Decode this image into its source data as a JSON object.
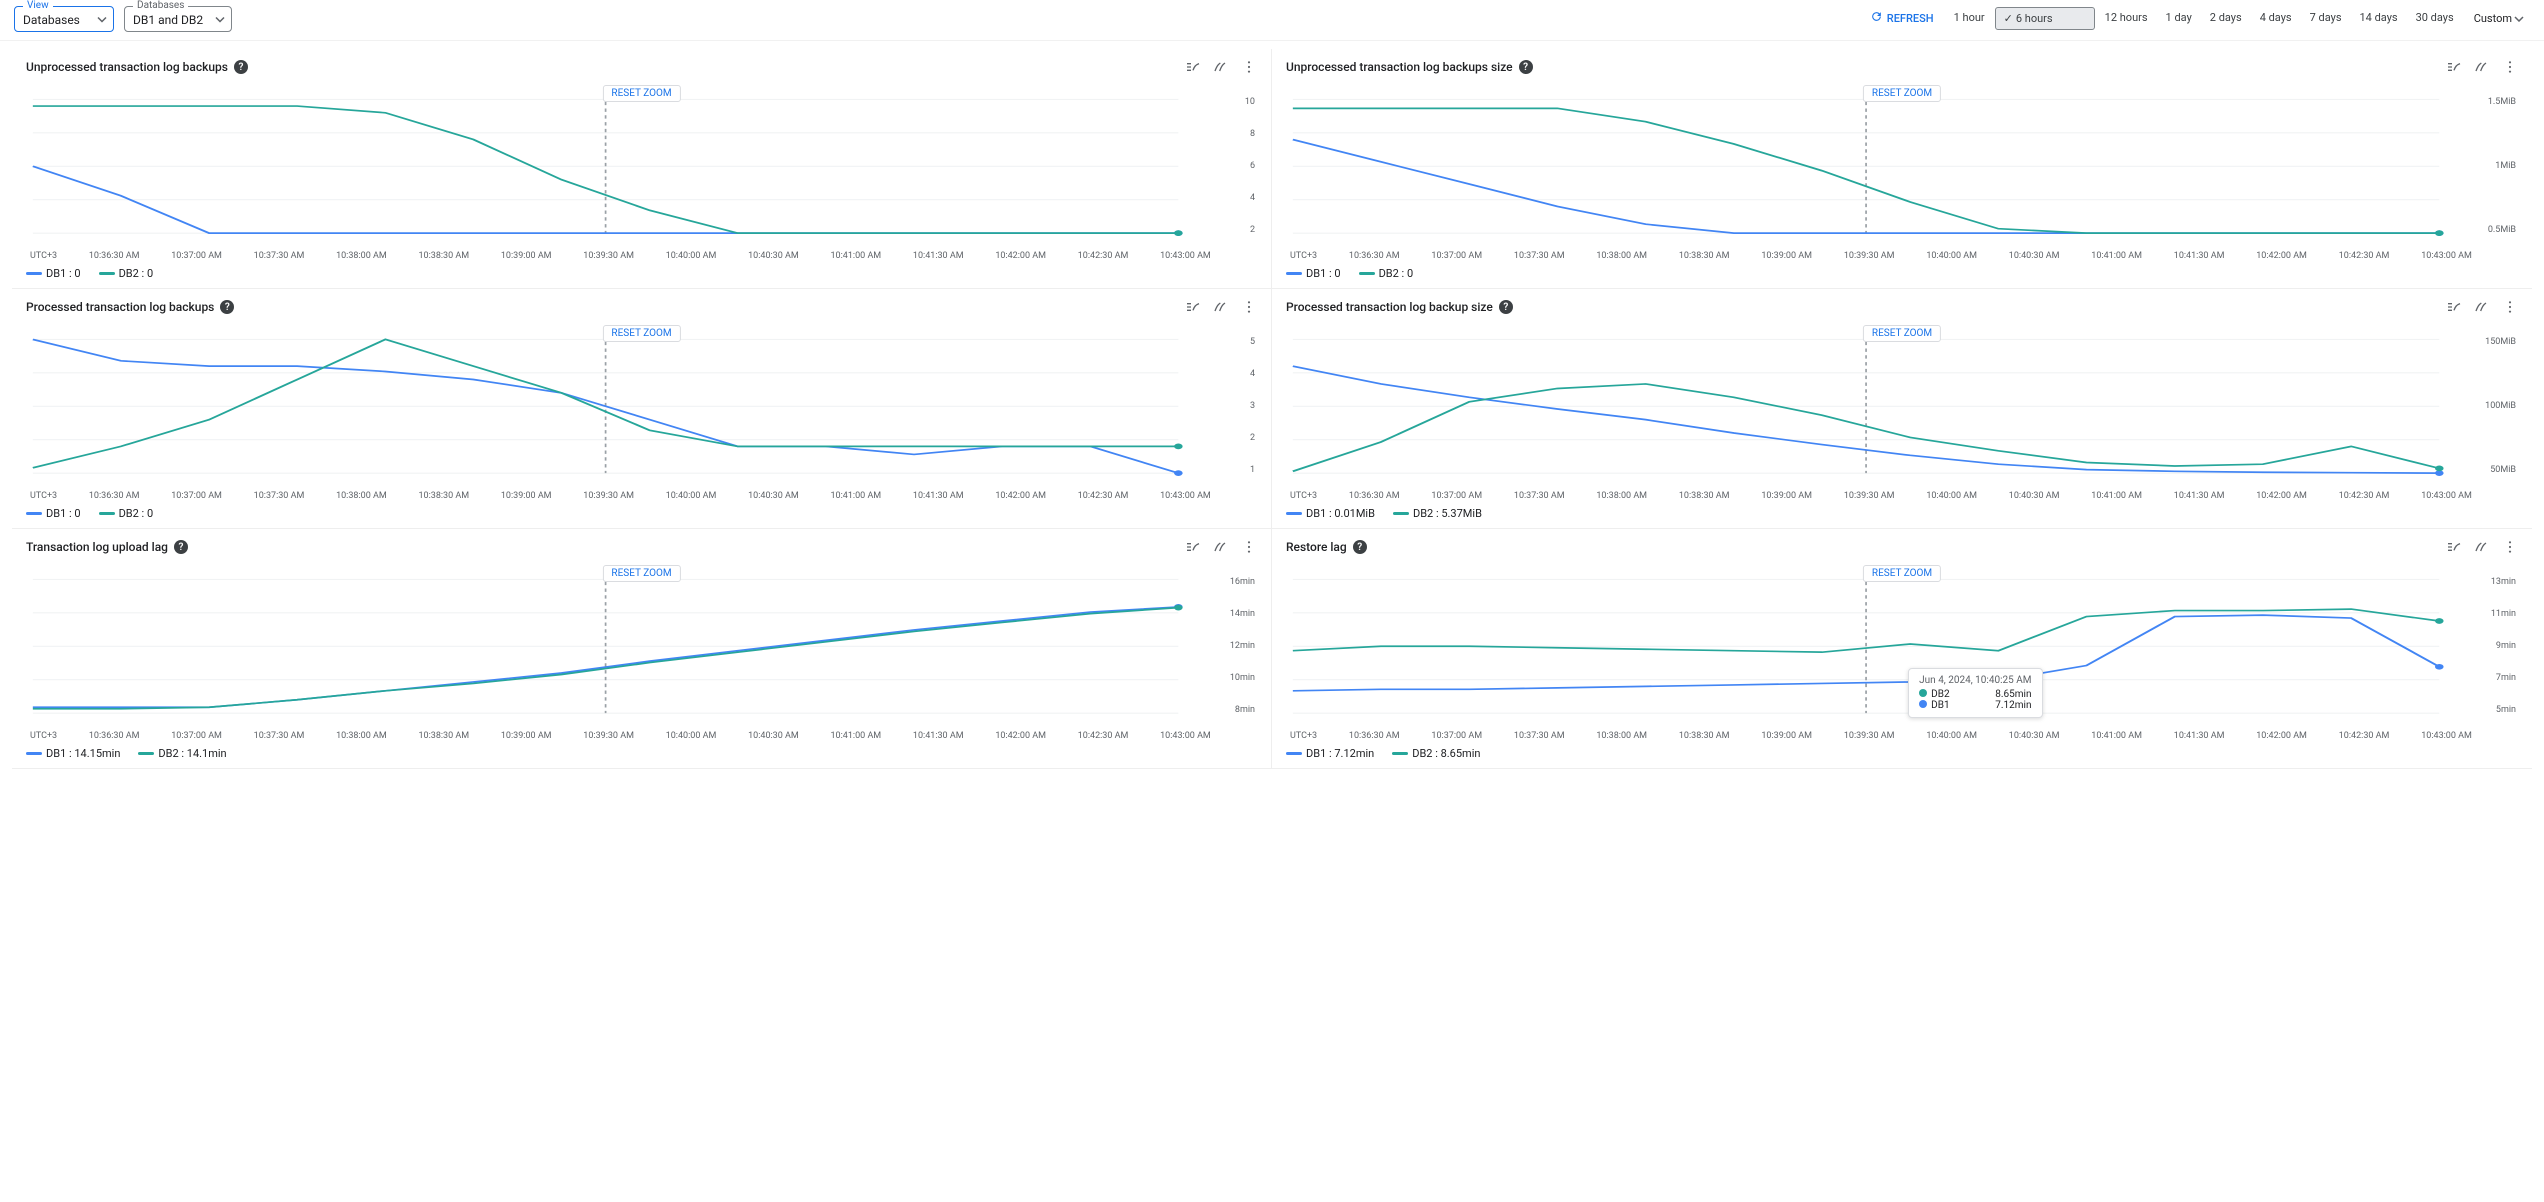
{
  "selectors": {
    "view": {
      "label": "View",
      "value": "Databases"
    },
    "databases": {
      "label": "Databases",
      "value": "DB1 and DB2"
    }
  },
  "toolbar": {
    "refresh": "REFRESH",
    "ranges": [
      "1 hour",
      "6 hours",
      "12 hours",
      "1 day",
      "2 days",
      "4 days",
      "7 days",
      "14 days",
      "30 days"
    ],
    "selected_index": 1,
    "custom": "Custom"
  },
  "common": {
    "reset_zoom": "RESET ZOOM",
    "tz": "UTC+3",
    "x_ticks": [
      "10:36:30 AM",
      "10:37:00 AM",
      "10:37:30 AM",
      "10:38:00 AM",
      "10:38:30 AM",
      "10:39:00 AM",
      "10:39:30 AM",
      "10:40:00 AM",
      "10:40:30 AM",
      "10:41:00 AM",
      "10:41:30 AM",
      "10:42:00 AM",
      "10:42:30 AM",
      "10:43:00 AM"
    ]
  },
  "chart_data": [
    {
      "title": "Unprocessed transaction log backups",
      "type": "line",
      "y_ticks": [
        "10",
        "8",
        "6",
        "4",
        "2"
      ],
      "legend": {
        "db1": "DB1 : 0",
        "db2": "DB2 : 0"
      },
      "x": [
        0,
        1,
        2,
        3,
        4,
        5,
        6,
        7,
        8,
        9,
        10,
        11,
        12,
        13
      ],
      "series": [
        {
          "name": "DB1",
          "values": [
            5,
            2.8,
            0,
            0,
            0,
            0,
            0,
            0,
            0,
            0,
            0,
            0,
            0,
            0
          ]
        },
        {
          "name": "DB2",
          "values": [
            9.5,
            9.5,
            9.5,
            9.5,
            9,
            7,
            4,
            1.7,
            0,
            0,
            0,
            0,
            0,
            0
          ]
        }
      ],
      "ylim": [
        0,
        10
      ]
    },
    {
      "title": "Unprocessed transaction log backups size",
      "type": "line",
      "y_ticks": [
        "1.5MiB",
        "1MiB",
        "0.5MiB"
      ],
      "legend": {
        "db1": "DB1 : 0",
        "db2": "DB2 : 0"
      },
      "x": [
        0,
        1,
        2,
        3,
        4,
        5,
        6,
        7,
        8,
        9,
        10,
        11,
        12,
        13
      ],
      "series": [
        {
          "name": "DB1",
          "values": [
            1.05,
            0.8,
            0.55,
            0.3,
            0.1,
            0,
            0,
            0,
            0,
            0,
            0,
            0,
            0,
            0
          ]
        },
        {
          "name": "DB2",
          "values": [
            1.4,
            1.4,
            1.4,
            1.4,
            1.25,
            1.0,
            0.7,
            0.35,
            0.05,
            0,
            0,
            0,
            0,
            0
          ]
        }
      ],
      "ylim": [
        0,
        1.5
      ]
    },
    {
      "title": "Processed transaction log backups",
      "type": "line",
      "y_ticks": [
        "5",
        "4",
        "3",
        "2",
        "1"
      ],
      "legend": {
        "db1": "DB1 : 0",
        "db2": "DB2 : 0"
      },
      "x": [
        0,
        1,
        2,
        3,
        4,
        5,
        6,
        7,
        8,
        9,
        10,
        11,
        12,
        13
      ],
      "series": [
        {
          "name": "DB1",
          "values": [
            5,
            4.2,
            4,
            4,
            3.8,
            3.5,
            3,
            2,
            1,
            1,
            0.7,
            1,
            1,
            0
          ]
        },
        {
          "name": "DB2",
          "values": [
            0.2,
            1,
            2,
            3.5,
            5,
            4,
            3,
            1.6,
            1,
            1,
            1,
            1,
            1,
            1
          ]
        }
      ],
      "ylim": [
        0,
        5
      ]
    },
    {
      "title": "Processed transaction log backup size",
      "type": "line",
      "y_ticks": [
        "150MiB",
        "100MiB",
        "50MiB"
      ],
      "legend": {
        "db1": "DB1 : 0.01MiB",
        "db2": "DB2 : 5.37MiB"
      },
      "x": [
        0,
        1,
        2,
        3,
        4,
        5,
        6,
        7,
        8,
        9,
        10,
        11,
        12,
        13
      ],
      "series": [
        {
          "name": "DB1",
          "values": [
            120,
            100,
            85,
            72,
            60,
            45,
            32,
            20,
            10,
            4,
            2,
            1,
            0.5,
            0.01
          ]
        },
        {
          "name": "DB2",
          "values": [
            2,
            35,
            80,
            95,
            100,
            85,
            65,
            40,
            25,
            12,
            8,
            10,
            30,
            5.37
          ]
        }
      ],
      "ylim": [
        0,
        150
      ]
    },
    {
      "title": "Transaction log upload lag",
      "type": "line",
      "y_ticks": [
        "16min",
        "14min",
        "12min",
        "10min",
        "8min"
      ],
      "legend": {
        "db1": "DB1 : 14.15min",
        "db2": "DB2 : 14.1min"
      },
      "x": [
        0,
        1,
        2,
        3,
        4,
        5,
        6,
        7,
        8,
        9,
        10,
        11,
        12,
        13
      ],
      "series": [
        {
          "name": "DB1",
          "values": [
            7.4,
            7.4,
            7.4,
            7.9,
            8.5,
            9.1,
            9.7,
            10.5,
            11.2,
            11.9,
            12.6,
            13.2,
            13.8,
            14.15
          ]
        },
        {
          "name": "DB2",
          "values": [
            7.3,
            7.3,
            7.4,
            7.9,
            8.5,
            9.0,
            9.6,
            10.4,
            11.1,
            11.8,
            12.5,
            13.1,
            13.7,
            14.1
          ]
        }
      ],
      "ylim": [
        7,
        16
      ]
    },
    {
      "title": "Restore lag",
      "type": "line",
      "y_ticks": [
        "13min",
        "11min",
        "9min",
        "7min",
        "5min"
      ],
      "legend": {
        "db1": "DB1 : 7.12min",
        "db2": "DB2 : 8.65min"
      },
      "x": [
        0,
        1,
        2,
        3,
        4,
        5,
        6,
        7,
        8,
        9,
        10,
        11,
        12,
        13
      ],
      "series": [
        {
          "name": "DB1",
          "values": [
            5.5,
            5.6,
            5.6,
            5.7,
            5.8,
            5.9,
            6.0,
            6.1,
            6.2,
            7.2,
            10.5,
            10.6,
            10.4,
            7.12
          ]
        },
        {
          "name": "DB2",
          "values": [
            8.2,
            8.5,
            8.5,
            8.4,
            8.3,
            8.2,
            8.1,
            8.65,
            8.2,
            10.5,
            10.9,
            10.9,
            11.0,
            10.2
          ]
        }
      ],
      "ylim": [
        4,
        13
      ],
      "tooltip": {
        "time": "Jun 4, 2024, 10:40:25 AM",
        "rows": [
          {
            "name": "DB2",
            "value": "8.65min",
            "color": "#26a69a"
          },
          {
            "name": "DB1",
            "value": "7.12min",
            "color": "#4285f4"
          }
        ]
      }
    }
  ]
}
